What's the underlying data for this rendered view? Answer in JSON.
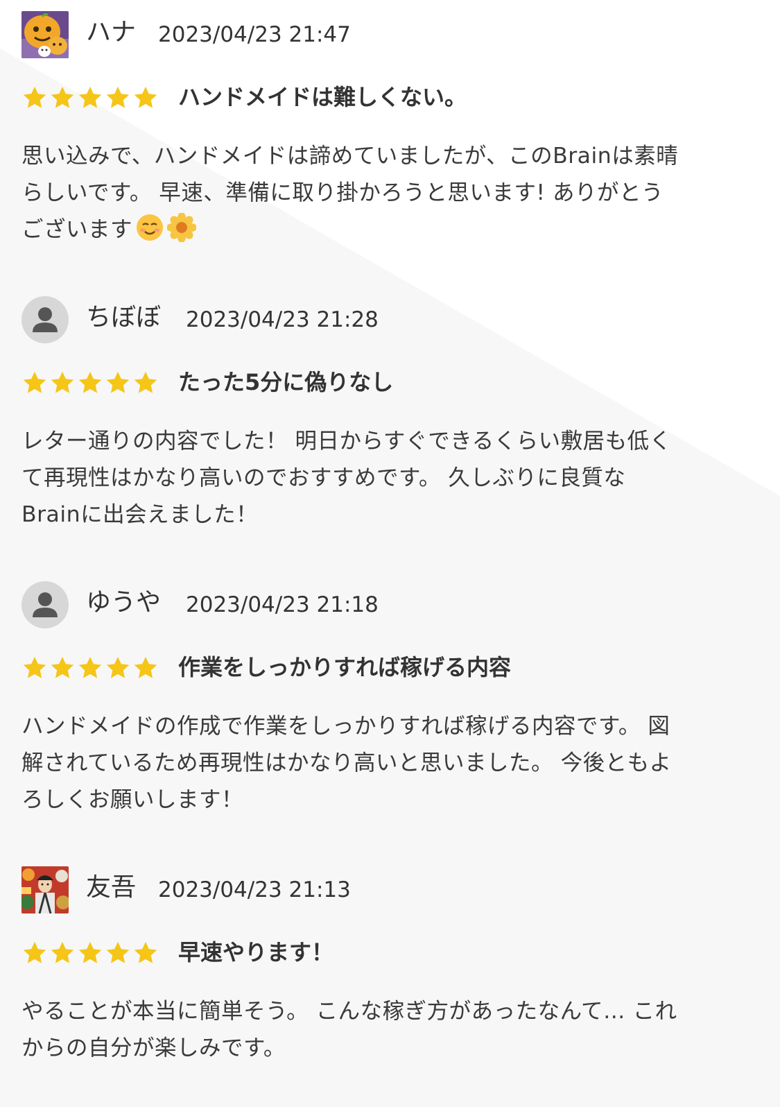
{
  "reviews": [
    {
      "username": "ハナ",
      "date": "2023/04/23 21:47",
      "avatar": "pumpkin-avatar-image",
      "rating": 5,
      "title": "ハンドメイドは難しくない。",
      "body": "思い込みで、ハンドメイドは諦めていましたが、このBrainは素晴\nらしいです。 早速、準備に取り掛かろうと思います! ありがとう\nございます",
      "emojis": [
        "smiling-face-emoji",
        "sunflower-emoji"
      ]
    },
    {
      "username": "ちぼぼ",
      "date": "2023/04/23 21:28",
      "avatar": "default-person-icon",
      "rating": 5,
      "title": "たった5分に偽りなし",
      "body": "レター通りの内容でした！ 明日からすぐできるくらい敷居も低く\nて再現性はかなり高いのでおすすめです。 久しぶりに良質な\nBrainに出会えました！"
    },
    {
      "username": "ゆうや",
      "date": "2023/04/23 21:18",
      "avatar": "default-person-icon",
      "rating": 5,
      "title": "作業をしっかりすれば稼げる内容",
      "body": "ハンドメイドの作成で作業をしっかりすれば稼げる内容です。 図\n解されているため再現性はかなり高いと思いました。 今後ともよ\nろしくお願いします！"
    },
    {
      "username": "友吾",
      "date": "2023/04/23 21:13",
      "avatar": "kimono-portrait-avatar-image",
      "rating": 5,
      "title": "早速やります！",
      "body": "やることが本当に簡単そう。 こんな稼ぎ方があったなんて… これ\nからの自分が楽しみです。"
    }
  ],
  "colors": {
    "star": "#f5c518",
    "text": "#333333",
    "background_shape": "#f6f7f6",
    "avatar_placeholder": "#d7d7d7",
    "avatar_person": "#555555"
  }
}
